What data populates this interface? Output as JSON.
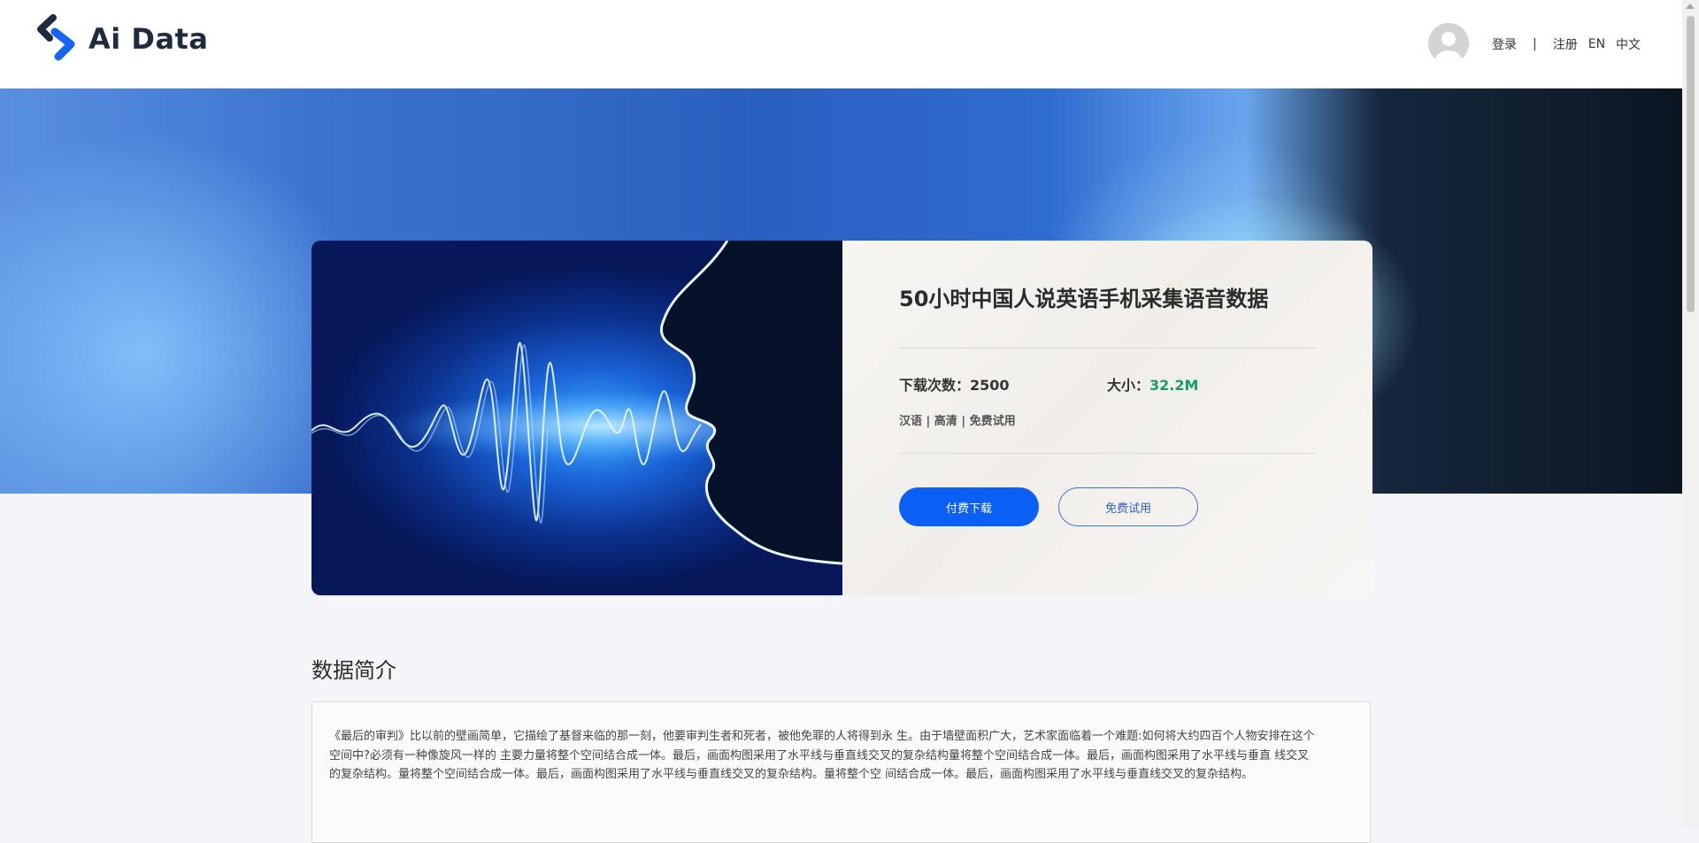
{
  "header": {
    "logo_text": "Ai Data",
    "nav": {
      "login": "登录",
      "separator": "|",
      "register": "注册",
      "lang_en": "EN",
      "lang_zh": "中文"
    }
  },
  "product": {
    "title": "50小时中国人说英语手机采集语音数据",
    "downloads_label": "下载次数：",
    "downloads_value": "2500",
    "size_label": "大小：",
    "size_value": "32.2M",
    "tags": "汉语 | 高清 | 免费试用",
    "paid_download_label": "付费下载",
    "free_trial_label": "免费试用"
  },
  "intro": {
    "title": "数据简介",
    "text": "《最后的审判》比以前的壁画简单，它描绘了基督来临的那一刻，他要审判生者和死者，被他免罪的人将得到永 生。由于墙壁面积广大，艺术家面临着一个难题:如何将大约四百个人物安排在这个空间中?必须有一种像旋风一样的 主要力量将整个空间结合成一体。最后，画面构图采用了水平线与垂直线交叉的复杂结构量将整个空间结合成一体。最后，画面构图采用了水平线与垂直 线交叉的复杂结构。量将整个空间结合成一体。最后，画面构图采用了水平线与垂直线交叉的复杂结构。量将整个空 间结合成一体。最后，画面构图采用了水平线与垂直线交叉的复杂结构。"
  },
  "colors": {
    "brand_blue": "#0b5ff5",
    "size_green": "#1a9b6b"
  },
  "icons": [
    "logo-icon",
    "avatar-icon",
    "sound-wave-face-image"
  ]
}
